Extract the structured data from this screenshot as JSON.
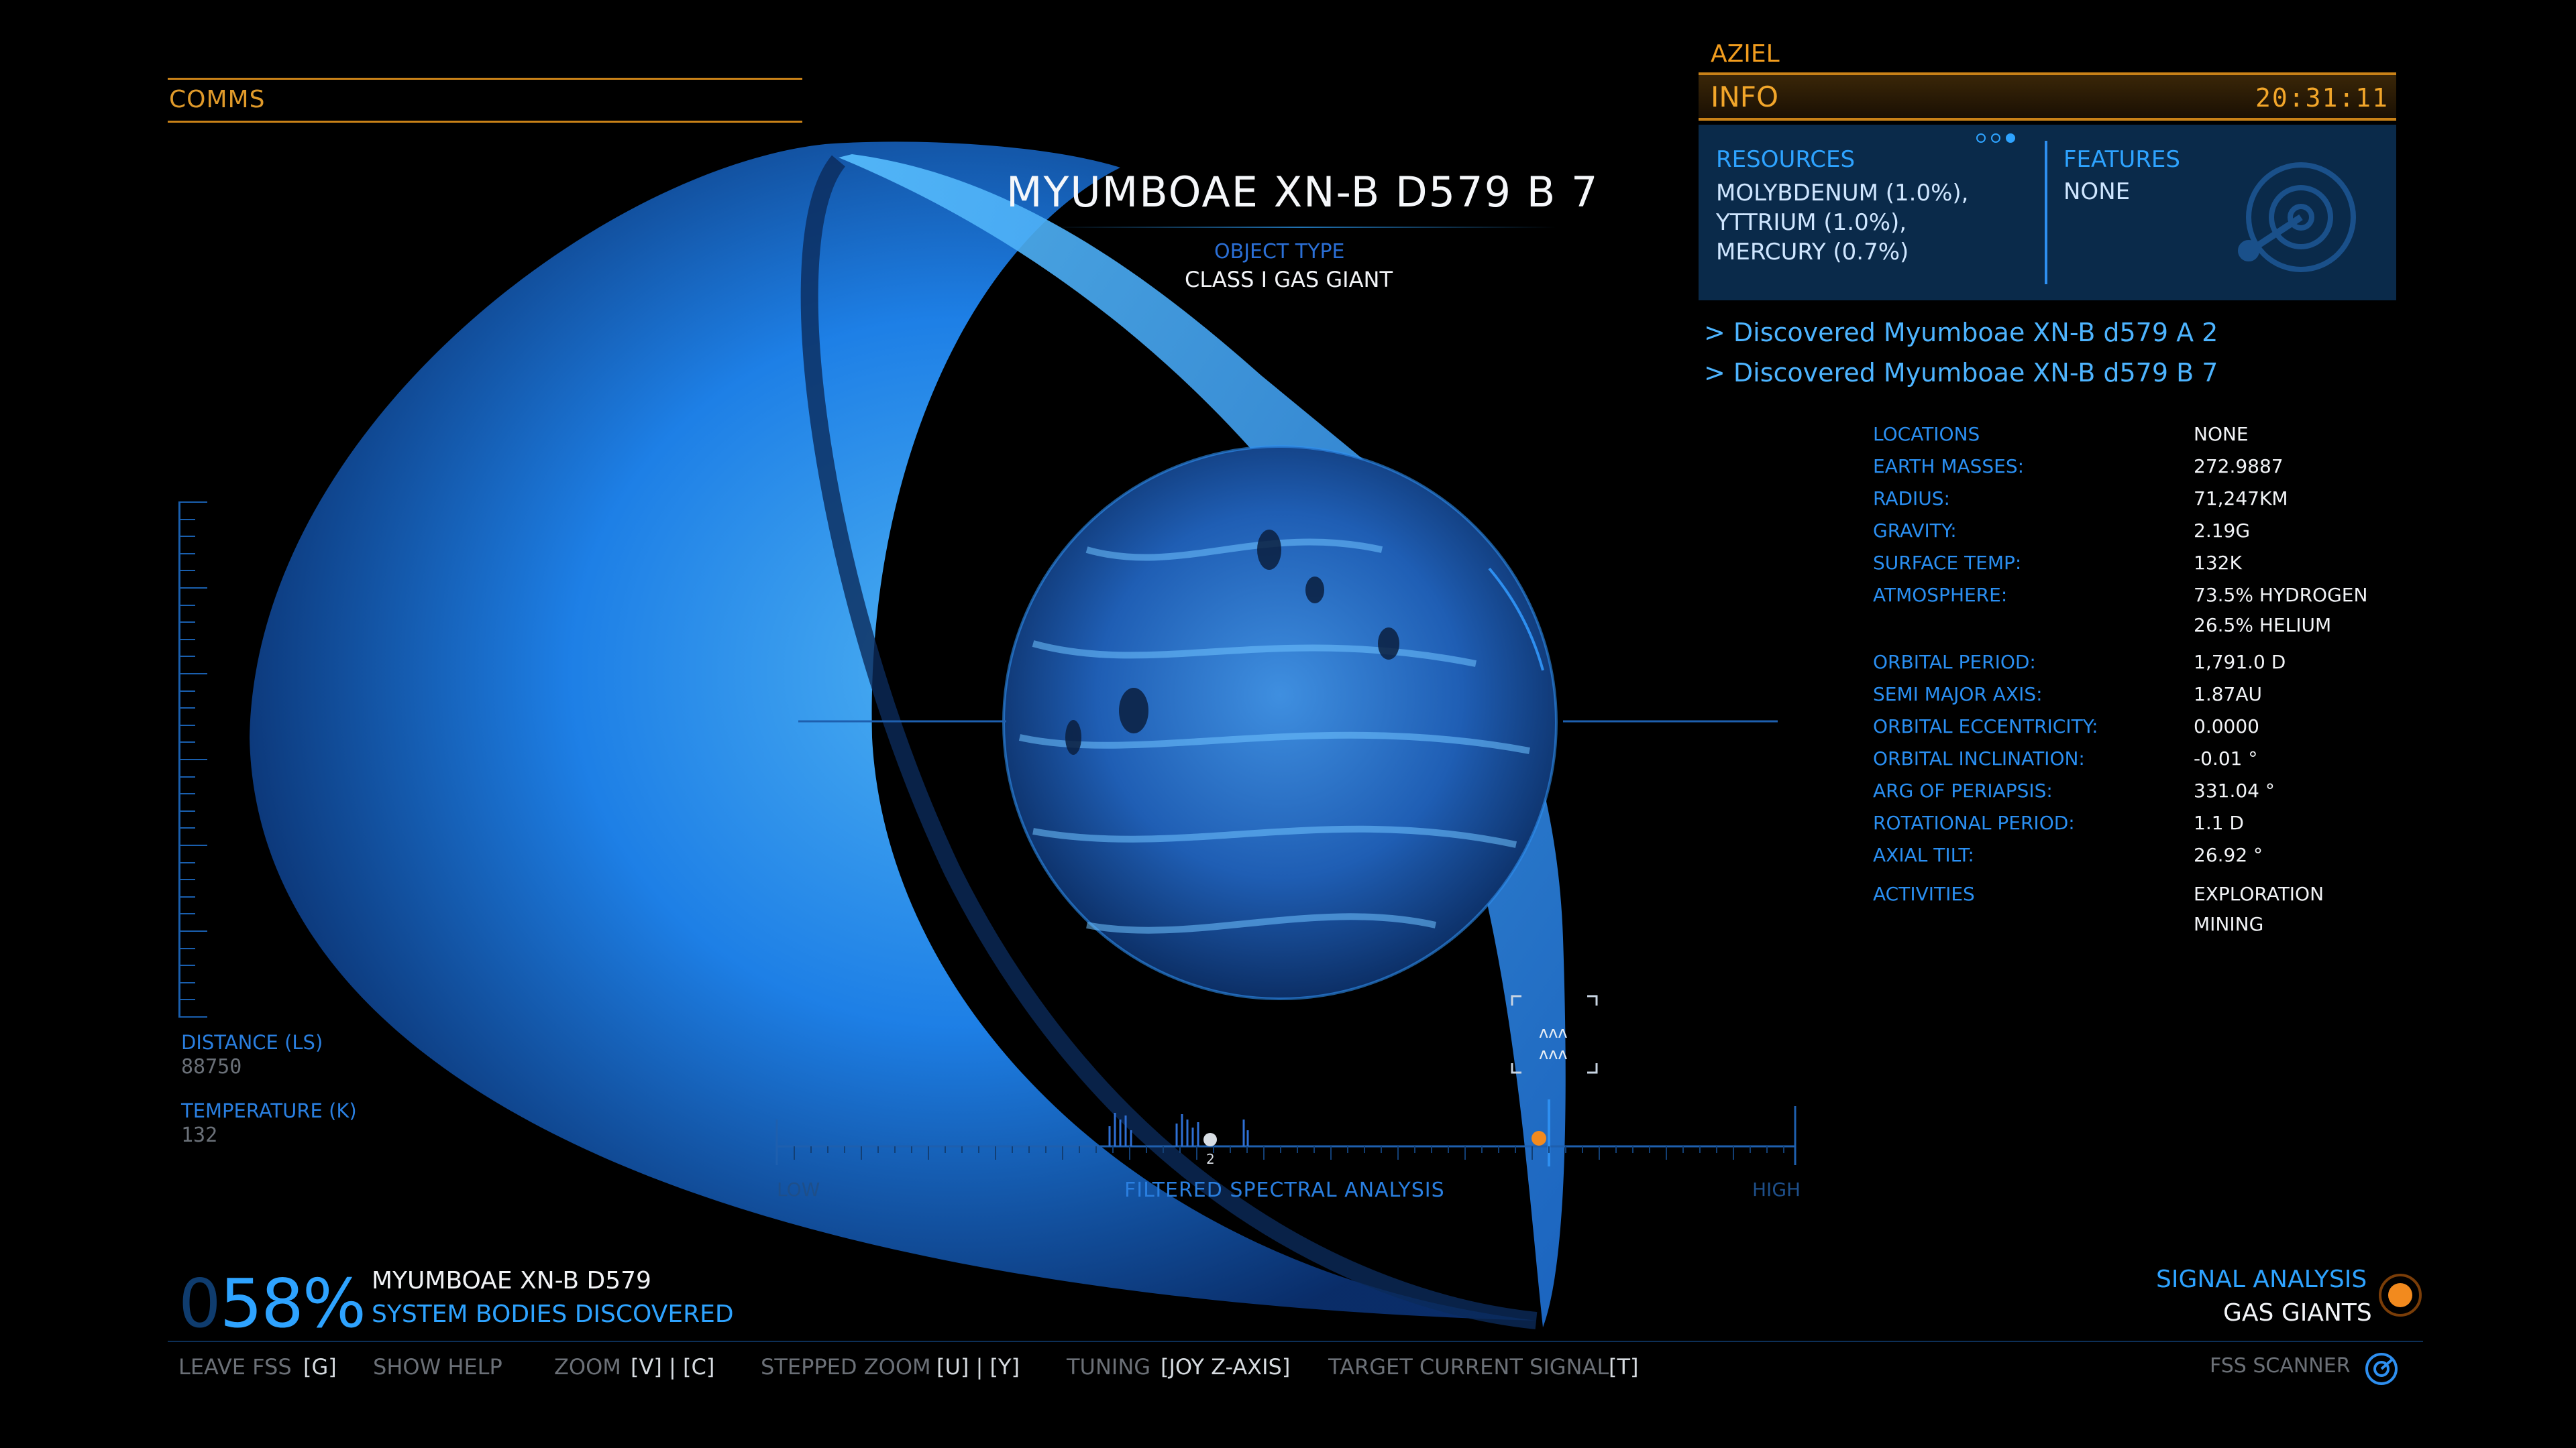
{
  "comms": {
    "label": "COMMS"
  },
  "body": {
    "title": "MYUMBOAE XN-B D579 B 7",
    "object_type_label": "OBJECT TYPE",
    "object_type_value": "CLASS I GAS GIANT"
  },
  "info": {
    "commander": "AZIEL",
    "title": "INFO",
    "time": "20:31:11",
    "pages": 3,
    "active_page": 3,
    "resources_title": "RESOURCES",
    "resources": [
      "MOLYBDENUM (1.0%),",
      "YTTRIUM (1.0%),",
      "MERCURY (0.7%)"
    ],
    "features_title": "FEATURES",
    "features_value": "NONE"
  },
  "log": [
    "> Discovered Myumboae XN-B d579 A 2",
    "> Discovered Myumboae XN-B d579 B 7"
  ],
  "stats": [
    {
      "k": "LOCATIONS",
      "v": "NONE"
    },
    {
      "k": "EARTH MASSES:",
      "v": "272.9887"
    },
    {
      "k": "RADIUS:",
      "v": "71,247KM"
    },
    {
      "k": "GRAVITY:",
      "v": "2.19G"
    },
    {
      "k": "SURFACE TEMP:",
      "v": "132K"
    },
    {
      "k": "ATMOSPHERE:",
      "v": "73.5% HYDROGEN",
      "v2": "26.5% HELIUM"
    },
    {
      "k": "ORBITAL PERIOD:",
      "v": "1,791.0 D"
    },
    {
      "k": "SEMI MAJOR AXIS:",
      "v": "1.87AU"
    },
    {
      "k": "ORBITAL ECCENTRICITY:",
      "v": "0.0000"
    },
    {
      "k": "ORBITAL INCLINATION:",
      "v": "-0.01 °"
    },
    {
      "k": "ARG OF PERIAPSIS:",
      "v": "331.04 °"
    },
    {
      "k": "ROTATIONAL PERIOD:",
      "v": "1.1 D"
    },
    {
      "k": "AXIAL TILT:",
      "v": "26.92 °"
    },
    {
      "k": "ACTIVITIES",
      "v": "EXPLORATION",
      "v2": "MINING"
    }
  ],
  "readouts": {
    "distance_label": "DISTANCE (LS)",
    "distance_value": "88750",
    "temperature_label": "TEMPERATURE (K)",
    "temperature_value": "132"
  },
  "spectrum": {
    "low": "LOW",
    "label": "FILTERED SPECTRAL ANALYSIS",
    "high": "HIGH",
    "signal_count": "2"
  },
  "discovery": {
    "percent_prefix": "0",
    "percent": "58%",
    "system": "MYUMBOAE XN-B D579",
    "label": "SYSTEM BODIES DISCOVERED"
  },
  "signal": {
    "label": "SIGNAL ANALYSIS",
    "value": "GAS GIANTS"
  },
  "footer": {
    "leave_label": "LEAVE FSS",
    "leave_key": "[G]",
    "help_label": "SHOW HELP",
    "zoom_label": "ZOOM",
    "zoom_key": "[V] | [C]",
    "stepped_label": "STEPPED ZOOM",
    "stepped_key": "[U] | [Y]",
    "tuning_label": "TUNING",
    "tuning_key": "[JOY Z-AXIS]",
    "target_label": "TARGET CURRENT SIGNAL",
    "target_key": "[T]",
    "fss_label": "FSS SCANNER"
  },
  "colors": {
    "accent_blue": "#2ea3ff",
    "hud_orange": "#f29d1e",
    "panel_bg": "#0a2a4a"
  }
}
